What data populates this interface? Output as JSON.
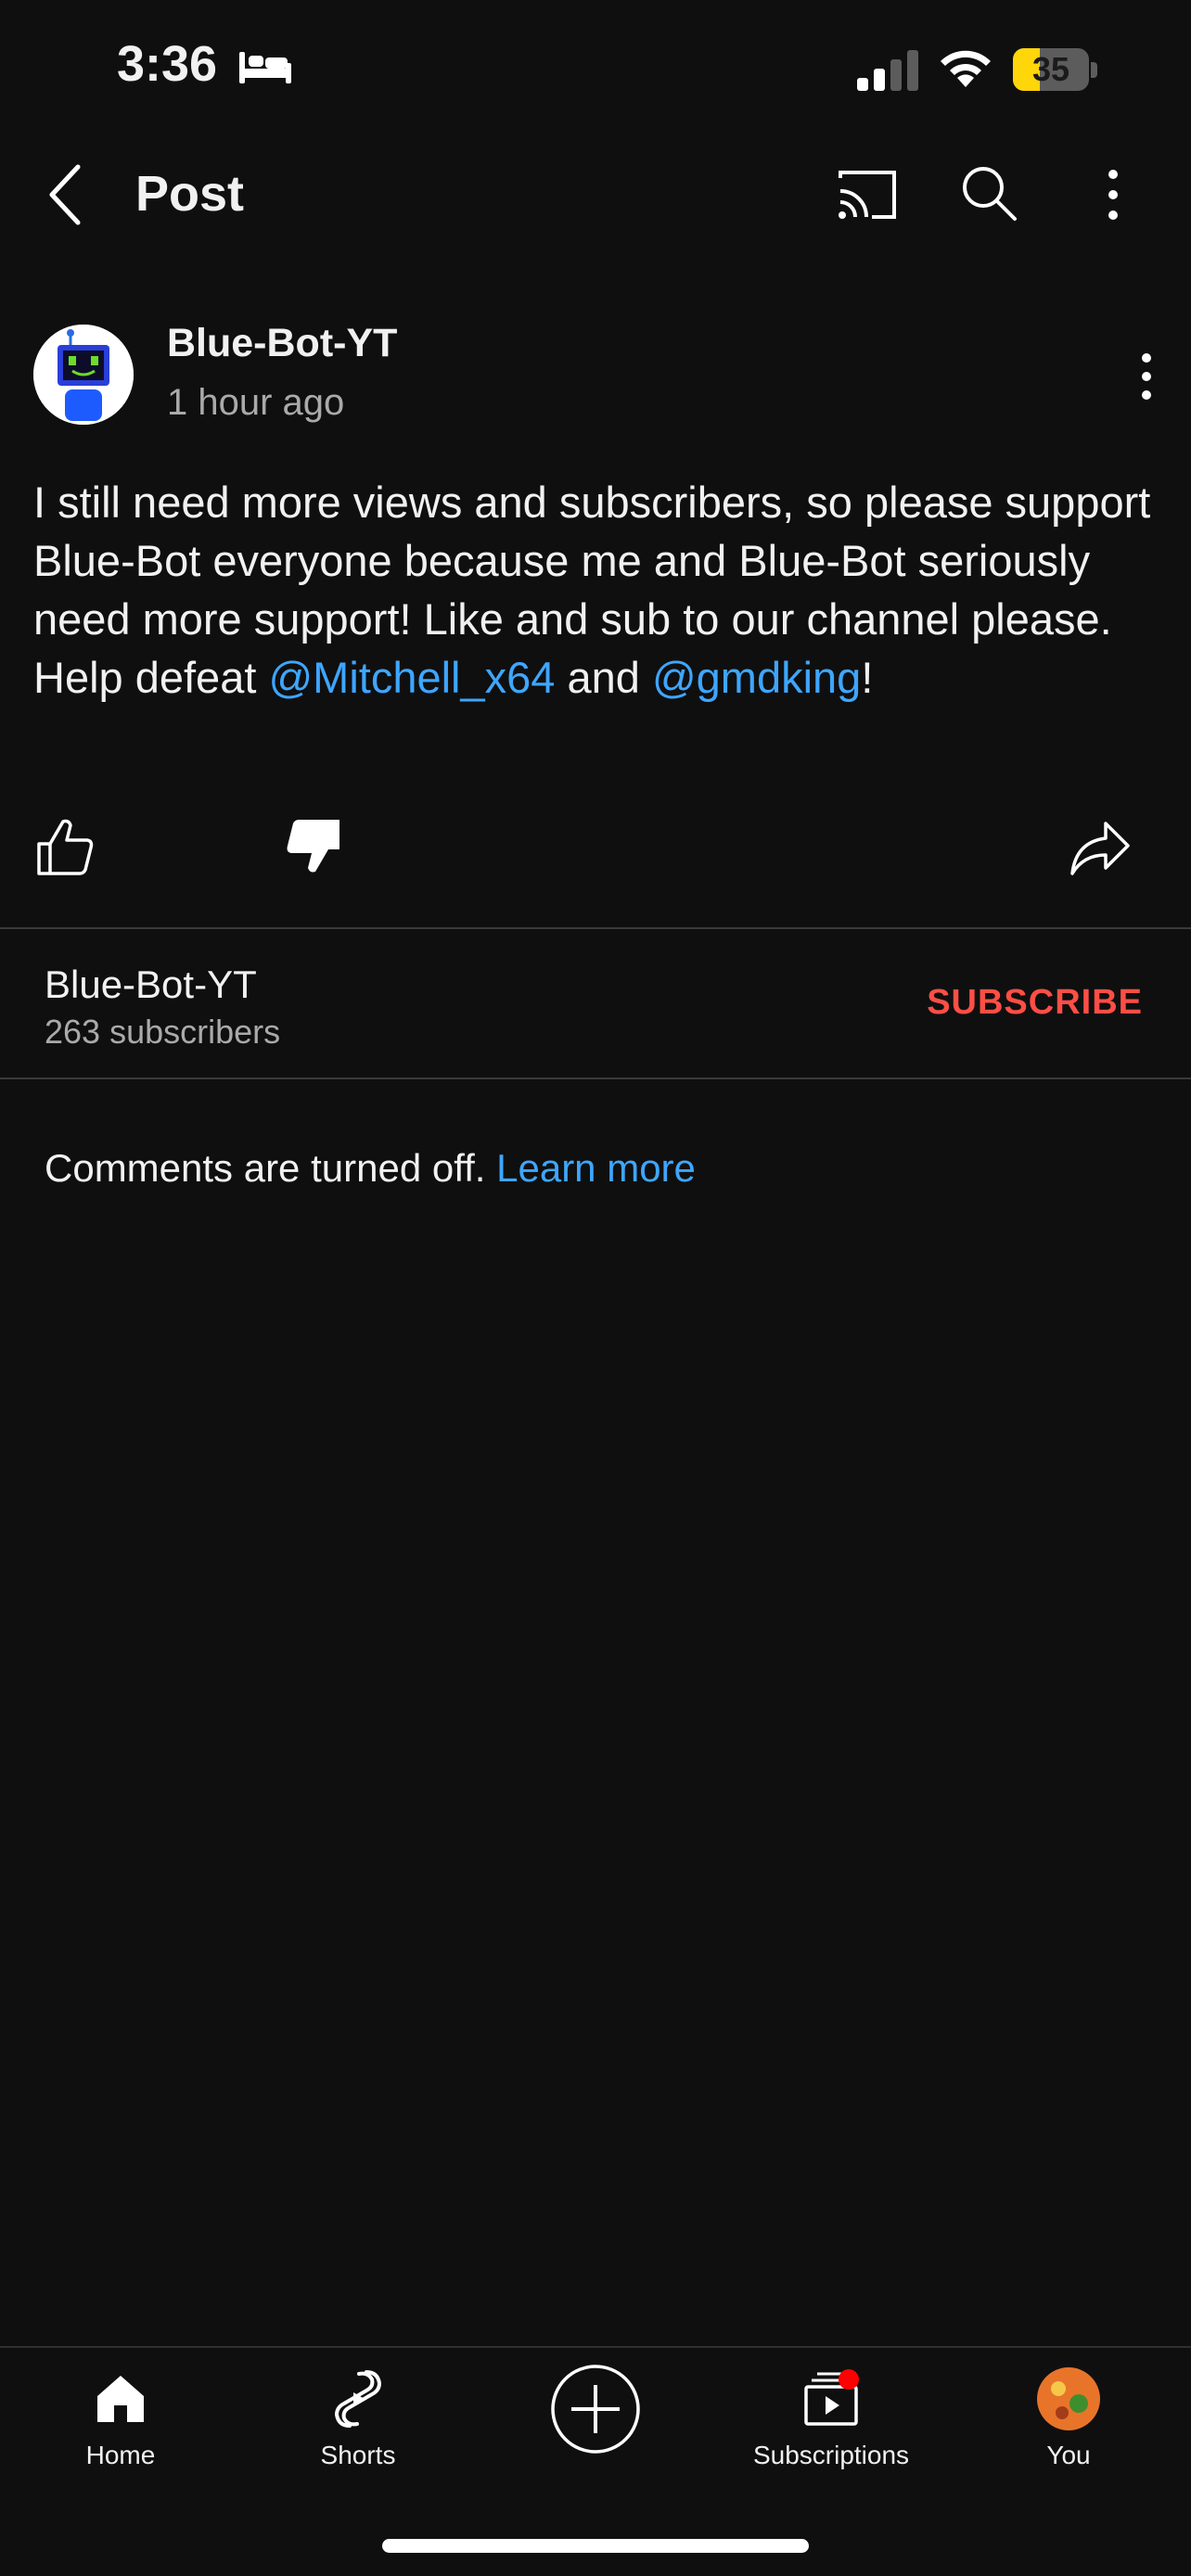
{
  "status_bar": {
    "time": "3:36",
    "battery_level": "35",
    "battery_fraction": 0.35,
    "focus_icon": "bed-icon"
  },
  "top_bar": {
    "title": "Post",
    "icons": [
      "back-icon",
      "cast-icon",
      "search-icon",
      "more-icon"
    ]
  },
  "post": {
    "channel_name": "Blue-Bot-YT",
    "posted": "1 hour ago",
    "body_text": "I still need more views and subscribers, so please support Blue-Bot everyone because me and Blue-Bot seriously need more support! Like and sub to our channel please. Help defeat ",
    "mention_1": "@Mitchell_x64",
    "between_mentions": " and ",
    "mention_2": "@gmdking",
    "ending": "!",
    "actions": [
      "like-icon",
      "dislike-icon",
      "share-icon"
    ]
  },
  "channel": {
    "name": "Blue-Bot-YT",
    "subscribers": "263 subscribers",
    "subscribe_label": "SUBSCRIBE"
  },
  "comments": {
    "notice": "Comments are turned off. ",
    "learn_more": "Learn more"
  },
  "bottom_nav": {
    "home": "Home",
    "shorts": "Shorts",
    "subscriptions": "Subscriptions",
    "you": "You"
  },
  "colors": {
    "background": "#0f0f0f",
    "link": "#3ea6ff",
    "subscribe": "#ff4e45",
    "secondary_text": "#aaaaaa",
    "notification_dot": "#ff0000",
    "battery": "#ffd60a"
  }
}
